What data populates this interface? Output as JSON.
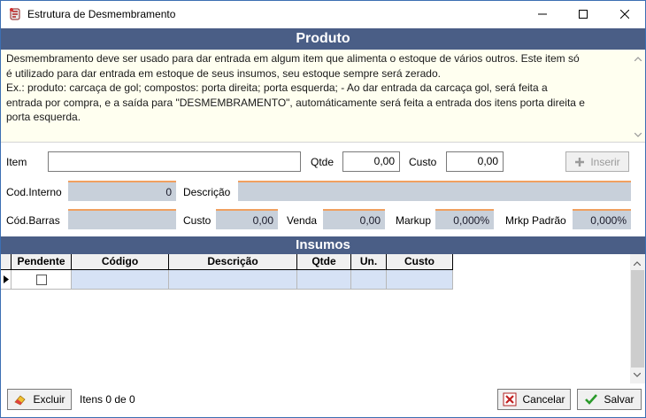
{
  "window": {
    "title": "Estrutura de Desmembramento",
    "minimize_glyph": "—",
    "maximize_glyph": "☐",
    "close_glyph": "✕"
  },
  "produto": {
    "header": "Produto",
    "description": "Desmembramento deve ser usado para dar entrada em algum item que alimenta o estoque de vários outros. Este item só\né utilizado para dar entrada em estoque de seus insumos, seu estoque sempre será zerado.\nEx.: produto: carcaça de gol; compostos: porta direita; porta esquerda; - Ao dar entrada da carcaça gol, será feita a\nentrada por compra, e a saída para \"DESMEMBRAMENTO\", automáticamente será feita a entrada dos itens porta direita e\nporta esquerda."
  },
  "form": {
    "item_label": "Item",
    "item_value": "",
    "qtde_label": "Qtde",
    "qtde_value": "0,00",
    "custo_label": "Custo",
    "custo_value": "0,00",
    "inserir_label": "Inserir",
    "cod_interno_label": "Cod.Interno",
    "cod_interno_value": "0",
    "descricao_label": "Descrição",
    "descricao_value": "",
    "cod_barras_label": "Cód.Barras",
    "cod_barras_value": "",
    "custo2_label": "Custo",
    "custo2_value": "0,00",
    "venda_label": "Venda",
    "venda_value": "0,00",
    "markup_label": "Markup",
    "markup_value": "0,000%",
    "mrkp_padrao_label": "Mrkp Padrão",
    "mrkp_padrao_value": "0,000%"
  },
  "insumos": {
    "header": "Insumos",
    "columns": [
      "Pendente",
      "Código",
      "Descrição",
      "Qtde",
      "Un.",
      "Custo"
    ]
  },
  "footer": {
    "excluir_label": "Excluir",
    "items_count": "Itens 0 de 0",
    "cancelar_label": "Cancelar",
    "salvar_label": "Salvar"
  },
  "colors": {
    "section_header": "#4a5e86",
    "memo_background": "#fffff0",
    "readonly_field": "#c8d0da",
    "field_accent": "#f0a060",
    "grid_row": "#d6e2f5"
  }
}
